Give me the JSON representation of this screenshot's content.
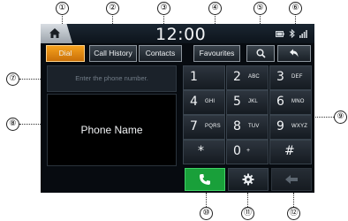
{
  "status_bar": {
    "time": "12:00"
  },
  "tabs": {
    "dial": "Dial",
    "call_history": "Call History",
    "contacts": "Contacts",
    "favourites": "Favourites"
  },
  "phone_input": {
    "placeholder": "Enter the phone number."
  },
  "name_panel": {
    "name": "Phone Name"
  },
  "keypad": [
    {
      "digit": "1",
      "letters": ""
    },
    {
      "digit": "2",
      "letters": "ABC"
    },
    {
      "digit": "3",
      "letters": "DEF"
    },
    {
      "digit": "4",
      "letters": "GHI"
    },
    {
      "digit": "5",
      "letters": "JKL"
    },
    {
      "digit": "6",
      "letters": "MNO"
    },
    {
      "digit": "7",
      "letters": "PQRS"
    },
    {
      "digit": "8",
      "letters": "TUV"
    },
    {
      "digit": "9",
      "letters": "WXYZ"
    },
    {
      "digit": "*",
      "letters": ""
    },
    {
      "digit": "0",
      "letters": "+"
    },
    {
      "digit": "#",
      "letters": ""
    }
  ],
  "callouts": [
    "①",
    "②",
    "③",
    "④",
    "⑤",
    "⑥",
    "⑦",
    "⑧",
    "⑨",
    "⑩",
    "⑪",
    "⑫"
  ],
  "icons": {
    "home": "home-icon",
    "search": "search-icon",
    "back": "return-arrow-icon",
    "call": "phone-handset-icon",
    "settings": "gear-icon",
    "delete": "left-arrow-icon"
  },
  "colors": {
    "active_tab": "#f39a1a",
    "call_button": "#19a03a",
    "screen_bg": "#070b10"
  }
}
